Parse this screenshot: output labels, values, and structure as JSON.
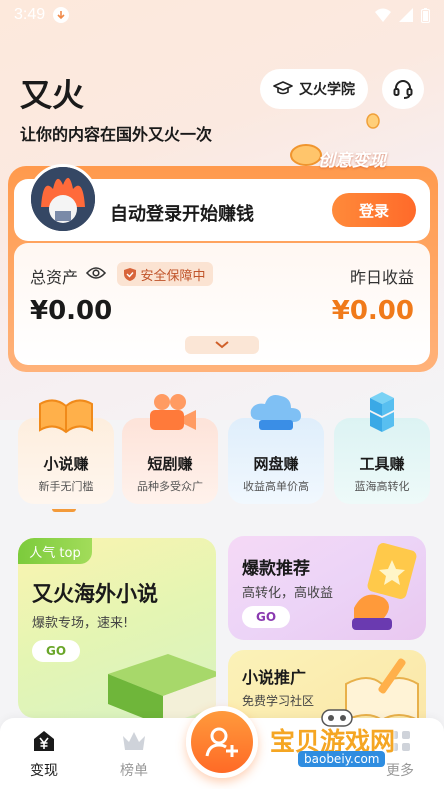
{
  "status_bar": {
    "time": "3:49"
  },
  "header": {
    "title": "又火",
    "subtitle": "让你的内容在国外又火一次",
    "academy_label": "又火学院",
    "creative_tag": "创意变现"
  },
  "login_card": {
    "prompt": "自动登录开始赚钱",
    "login_label": "登录",
    "total_assets_label": "总资产",
    "security_badge": "安全保障中",
    "total_assets_value": "¥0.00",
    "yesterday_label": "昨日收益",
    "yesterday_value": "¥0.00"
  },
  "categories": [
    {
      "title": "小说赚",
      "sub": "新手无门槛"
    },
    {
      "title": "短剧赚",
      "sub": "品种多受众广"
    },
    {
      "title": "网盘赚",
      "sub": "收益高单价高"
    },
    {
      "title": "工具赚",
      "sub": "蓝海高转化"
    }
  ],
  "promos": {
    "novel": {
      "tag": "人气 top",
      "title": "又火海外小说",
      "sub": "爆款专场，速来!",
      "go": "GO"
    },
    "hot": {
      "title": "爆款推荐",
      "sub": "高转化，高收益",
      "go": "GO"
    },
    "promo": {
      "title": "小说推广",
      "sub": "免费学习社区"
    }
  },
  "bottom_nav": {
    "items": [
      {
        "label": "变现"
      },
      {
        "label": "榜单"
      },
      {
        "label": "更多"
      }
    ]
  },
  "watermark": {
    "text": "宝贝游戏网",
    "url": "baobeiy.com"
  },
  "colors": {
    "accent": "#ff7a2e",
    "income": "#f07a1a",
    "green_tag": "#7ccb3c"
  }
}
